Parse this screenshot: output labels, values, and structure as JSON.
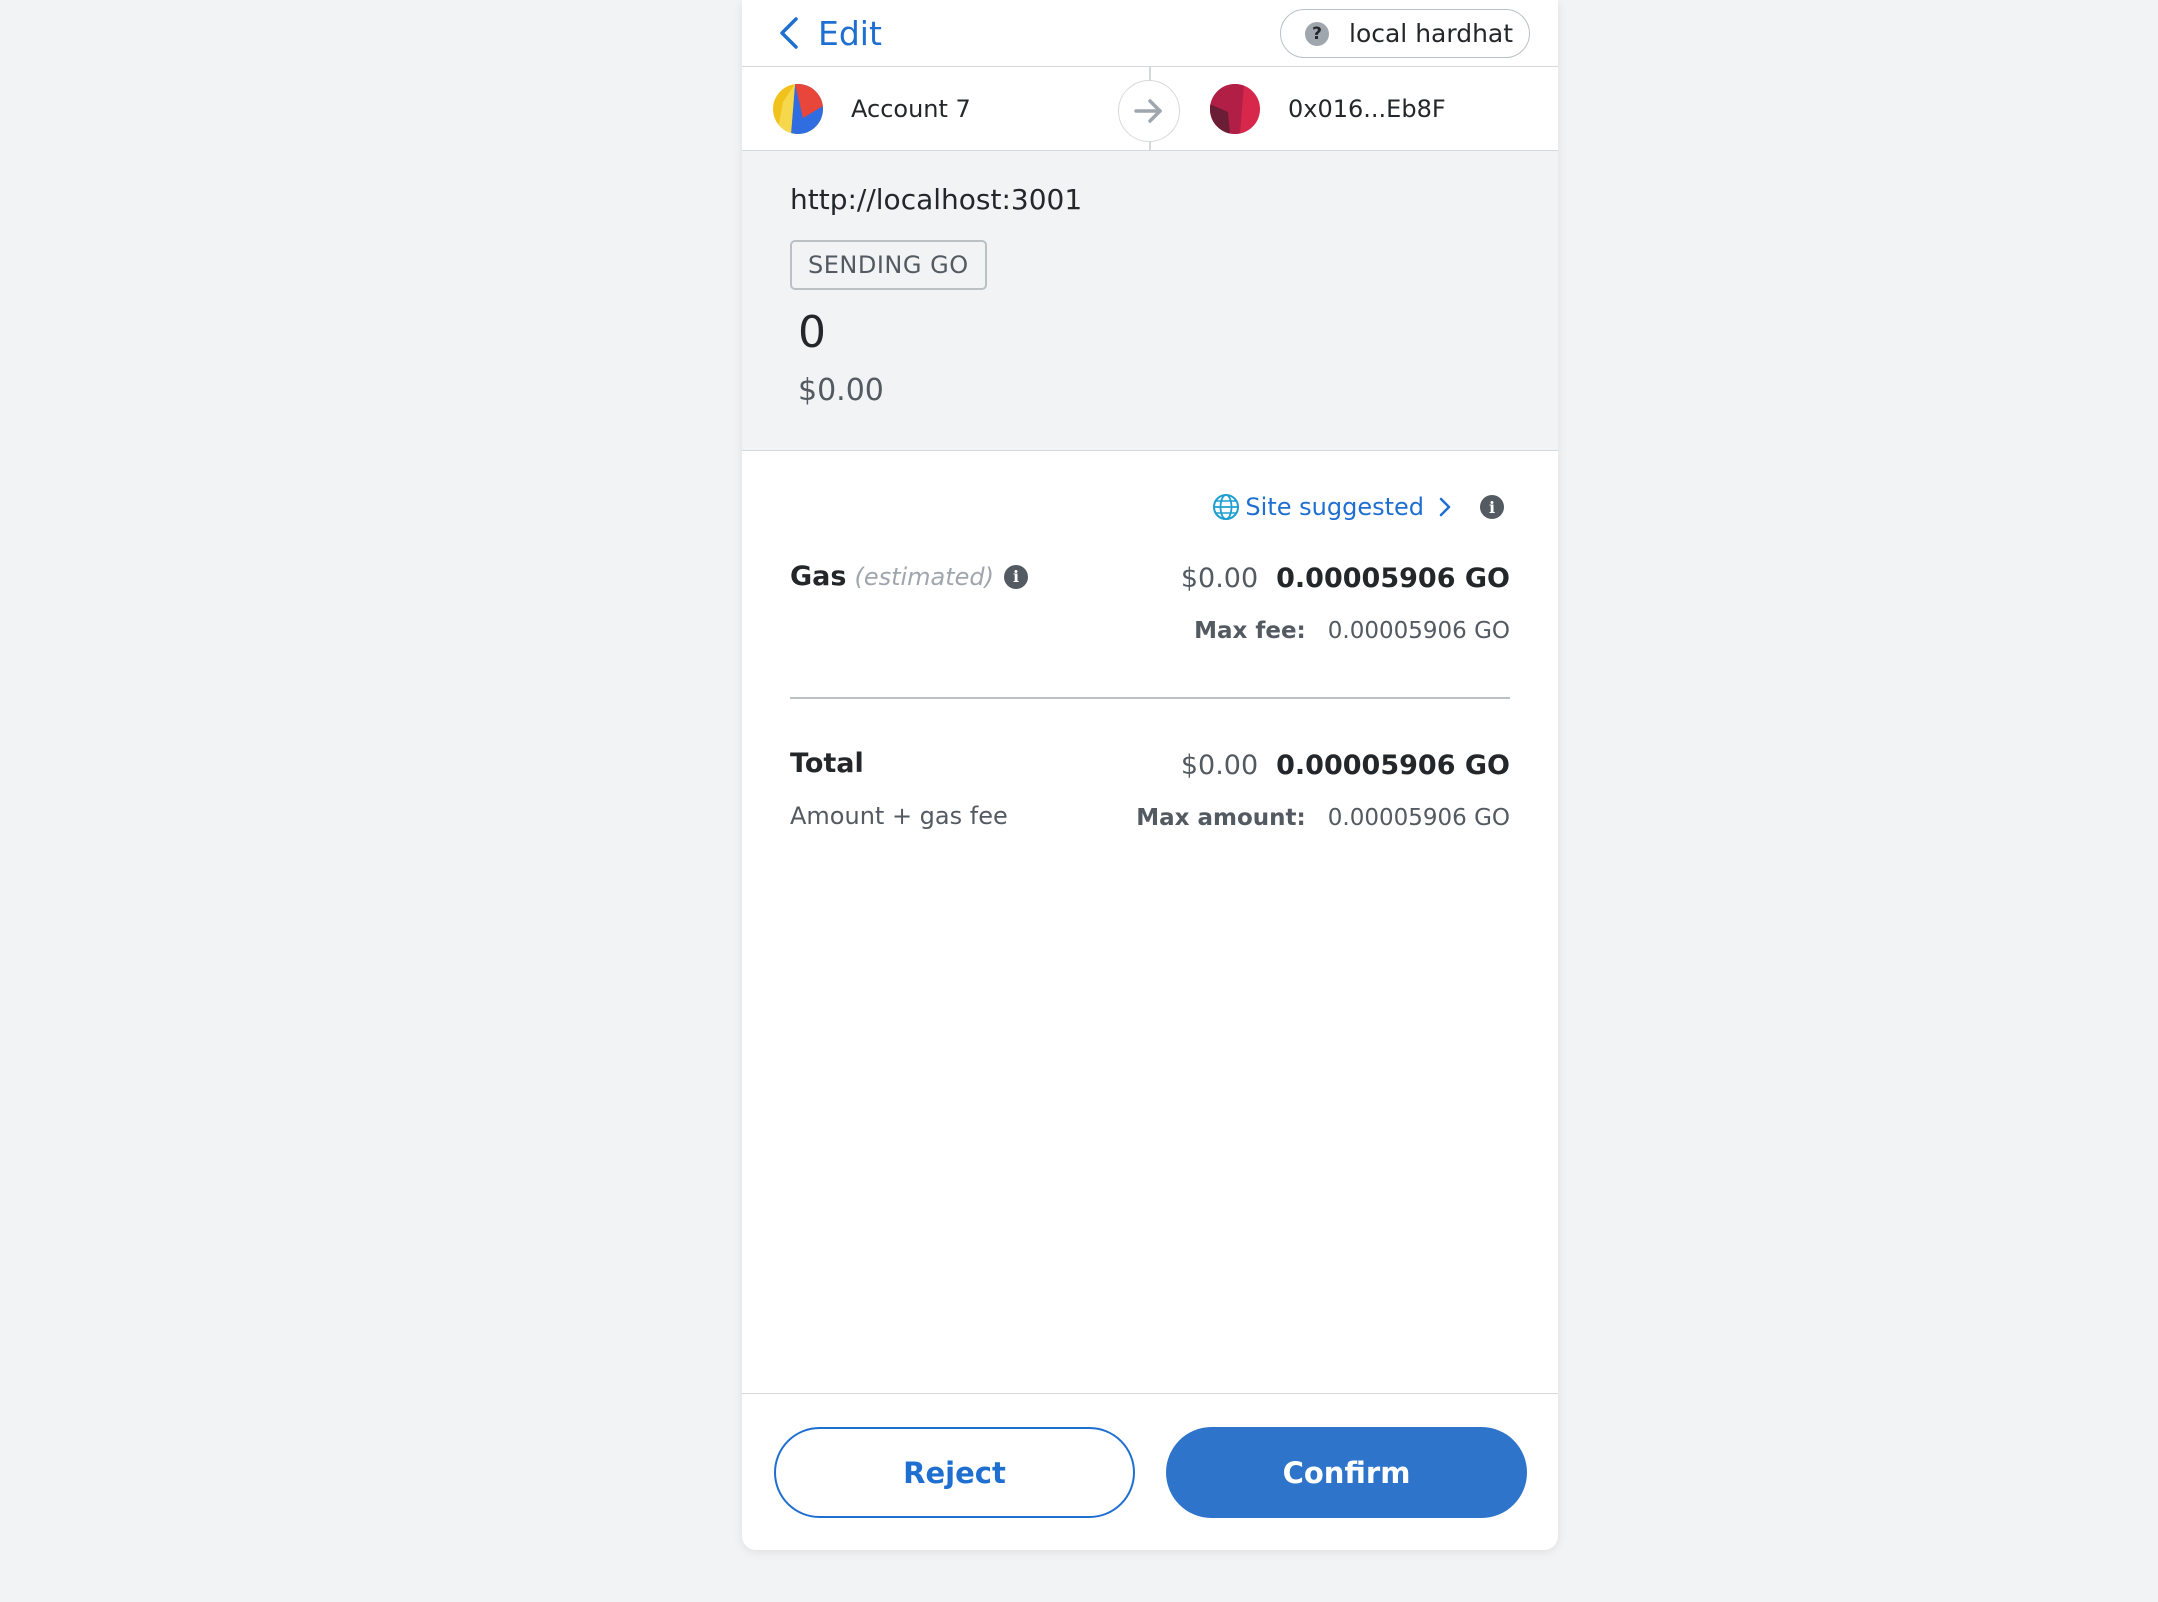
{
  "header": {
    "edit_label": "Edit",
    "network_label": "local hardhat",
    "network_icon": "question-icon"
  },
  "accounts": {
    "from_name": "Account 7",
    "to_address": "0x016...Eb8F"
  },
  "summary": {
    "origin": "http://localhost:3001",
    "action": "SENDING GO",
    "amount": "0",
    "fiat": "$0.00"
  },
  "gas": {
    "edit_label": "Site suggested",
    "label": "Gas",
    "label_sub": "(estimated)",
    "fiat": "$0.00",
    "crypto": "0.00005906 GO",
    "max_fee_label": "Max fee:",
    "max_fee_value": "0.00005906 GO"
  },
  "total": {
    "label": "Total",
    "sub_label": "Amount + gas fee",
    "fiat": "$0.00",
    "crypto": "0.00005906 GO",
    "max_amount_label": "Max amount:",
    "max_amount_value": "0.00005906 GO"
  },
  "footer": {
    "reject_label": "Reject",
    "confirm_label": "Confirm"
  },
  "colors": {
    "accent": "#1f6fd1",
    "confirm_bg": "#2f74cb",
    "background": "#f2f3f4"
  }
}
